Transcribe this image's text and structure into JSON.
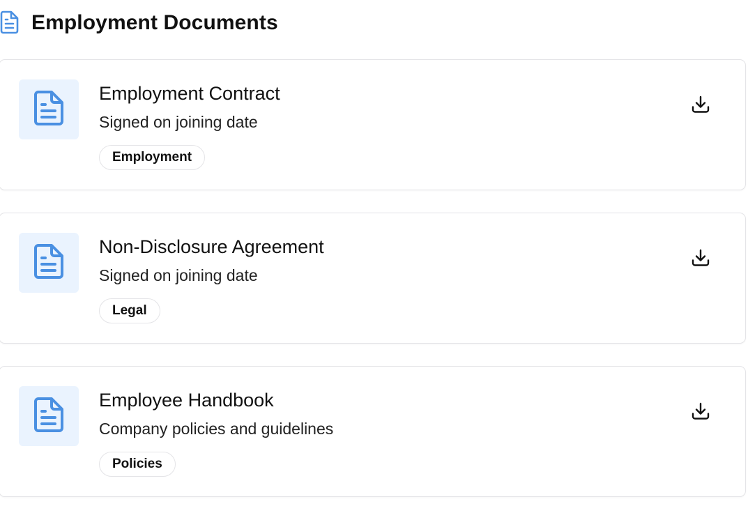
{
  "header": {
    "icon": "file-text-icon",
    "title": "Employment Documents"
  },
  "colors": {
    "accent": "#4a90e2",
    "tile_background": "#eaf3fe",
    "border": "#e4e4e7"
  },
  "documents": [
    {
      "icon": "file-text-icon",
      "title": "Employment Contract",
      "subtitle": "Signed on joining date",
      "tag": "Employment",
      "action_icon": "download-icon"
    },
    {
      "icon": "file-text-icon",
      "title": "Non-Disclosure Agreement",
      "subtitle": "Signed on joining date",
      "tag": "Legal",
      "action_icon": "download-icon"
    },
    {
      "icon": "file-text-icon",
      "title": "Employee Handbook",
      "subtitle": "Company policies and guidelines",
      "tag": "Policies",
      "action_icon": "download-icon"
    }
  ]
}
